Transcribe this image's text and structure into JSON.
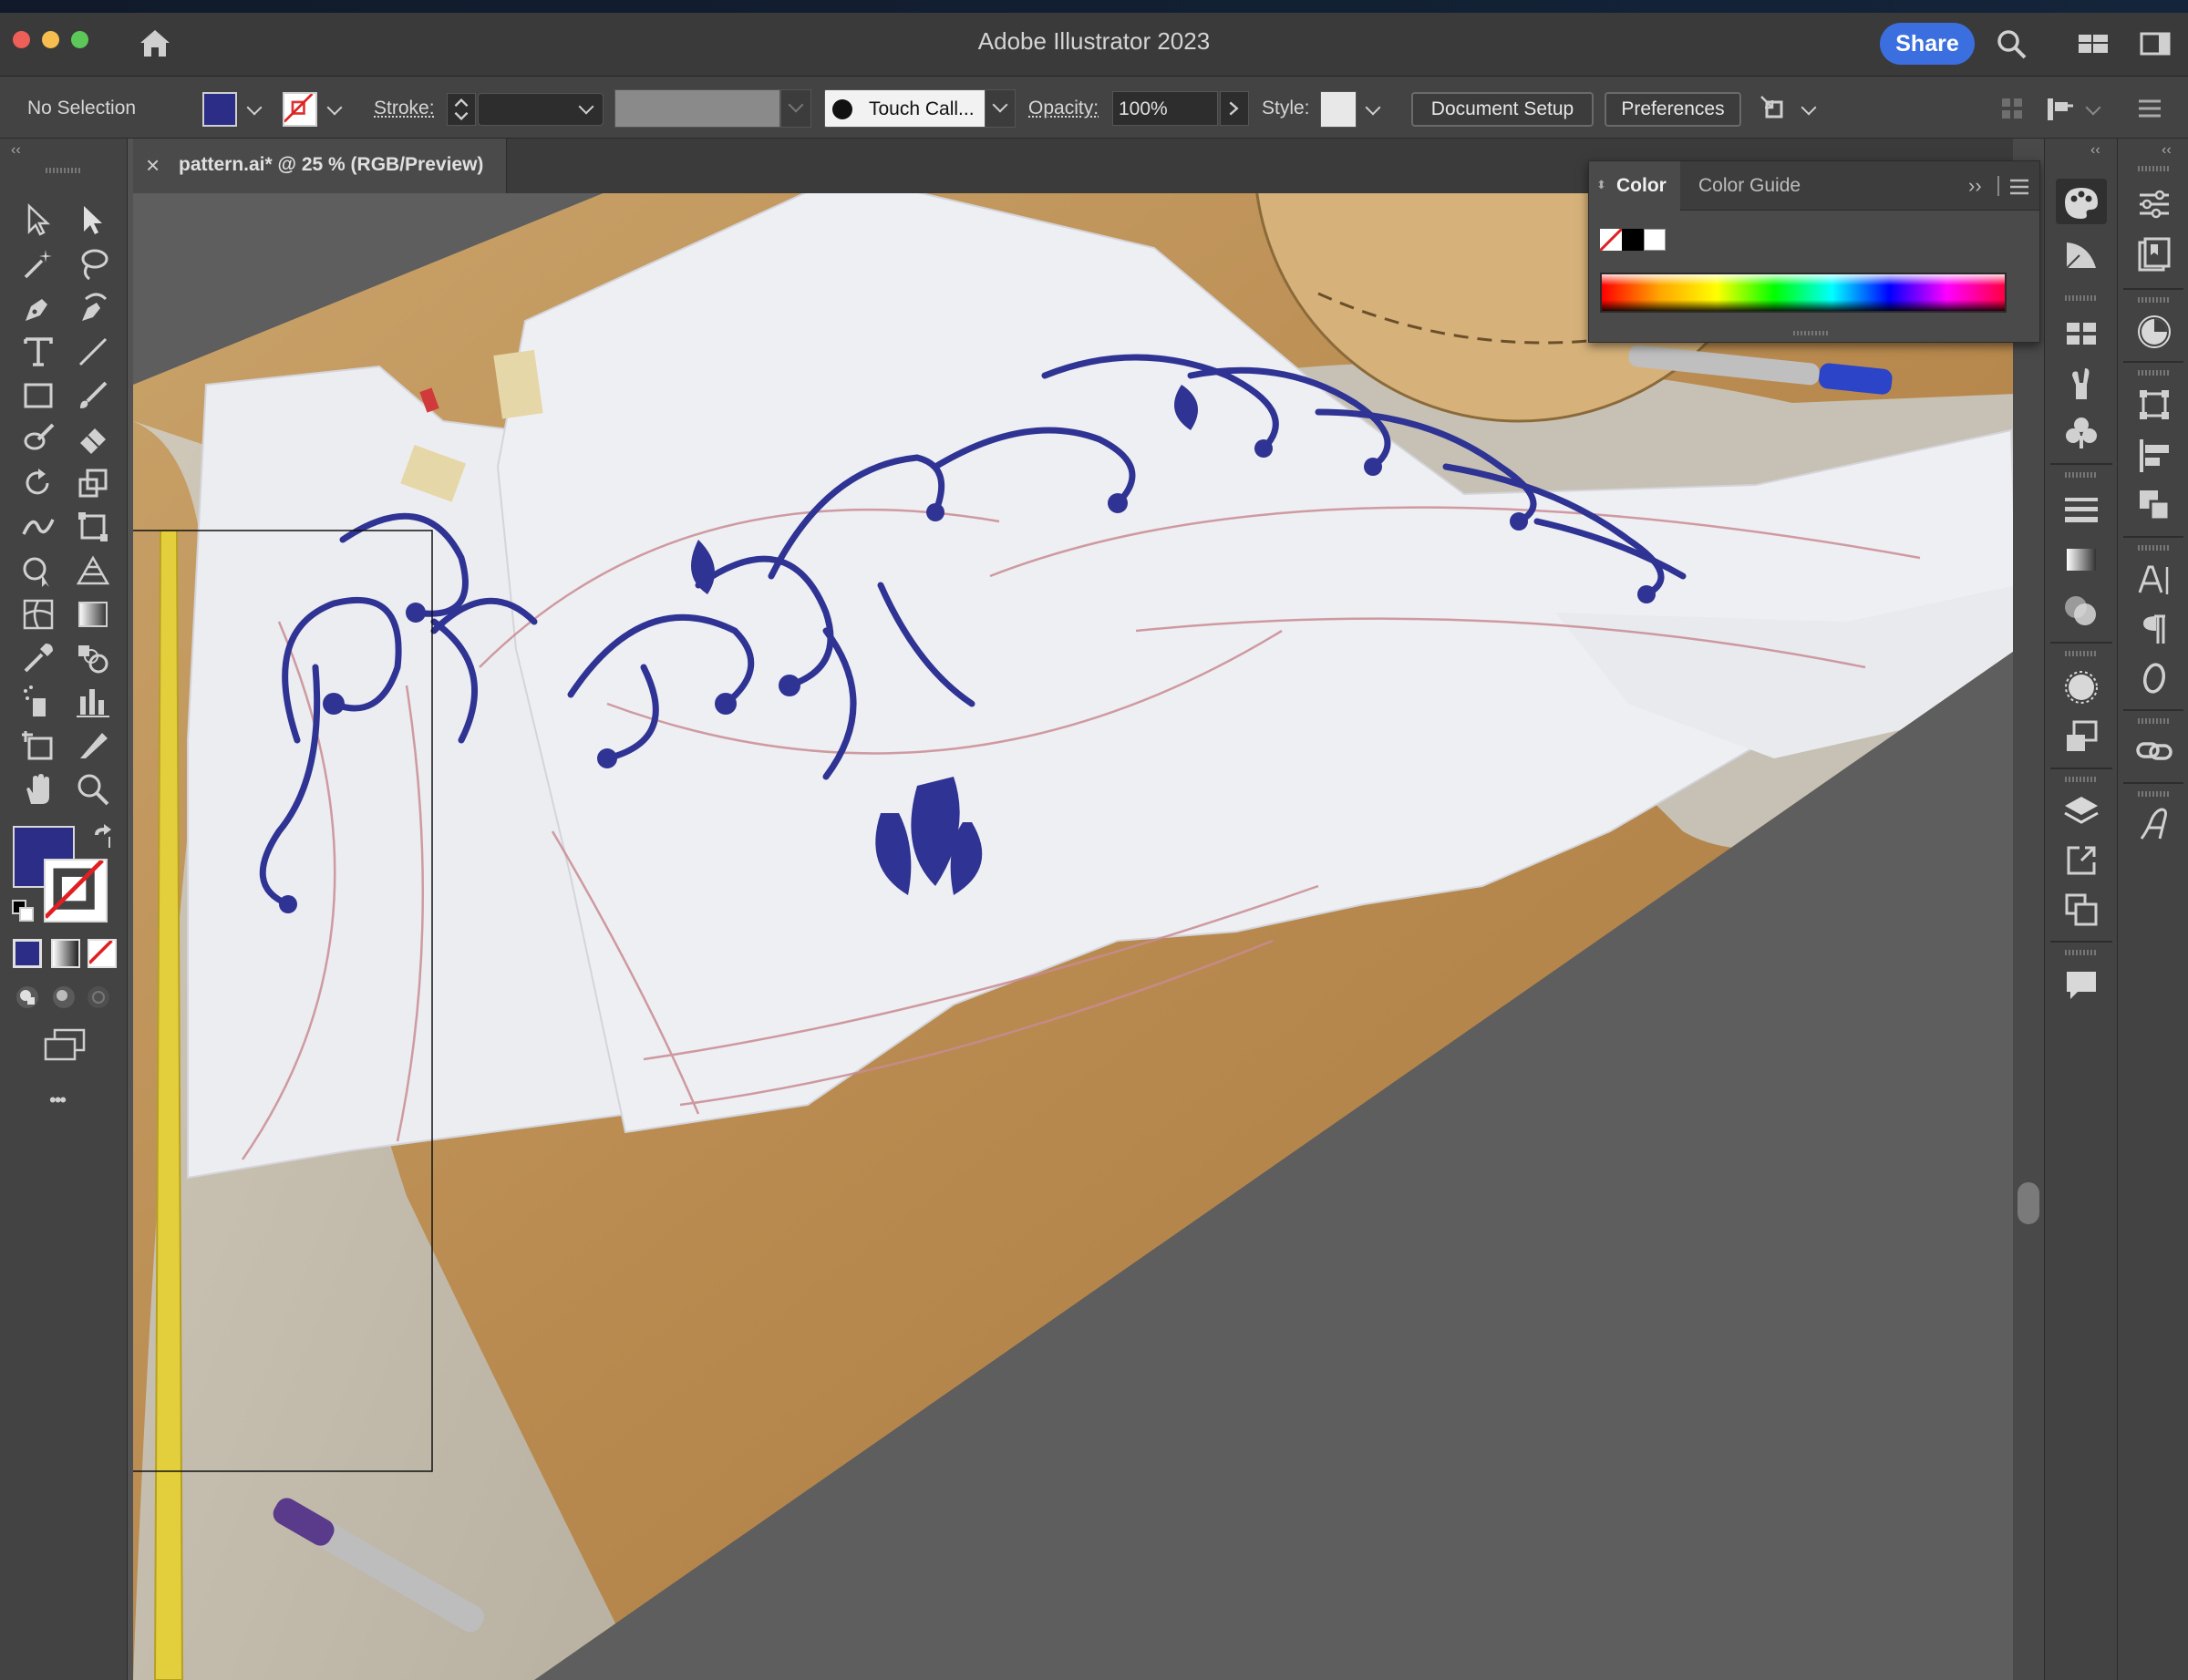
{
  "window": {
    "app_title": "Adobe Illustrator 2023",
    "share_label": "Share"
  },
  "control_bar": {
    "selection_label": "No Selection",
    "stroke_label": "Stroke:",
    "brush_label": "Touch Call...",
    "opacity_label": "Opacity:",
    "opacity_value": "100%",
    "style_label": "Style:",
    "document_setup_label": "Document Setup",
    "preferences_label": "Preferences"
  },
  "document_tab": {
    "close_glyph": "×",
    "title": "pattern.ai* @ 25 % (RGB/Preview)"
  },
  "color_panel": {
    "tabs": [
      "Color",
      "Color Guide"
    ],
    "expand_glyph": "››"
  },
  "toolbar": {
    "fill_color": "#2b2d86",
    "stroke_color": "none",
    "more_glyph": "•••"
  },
  "colors": {
    "accent_blue": "#3b6fe0",
    "ornament_blue": "#2f3393"
  }
}
